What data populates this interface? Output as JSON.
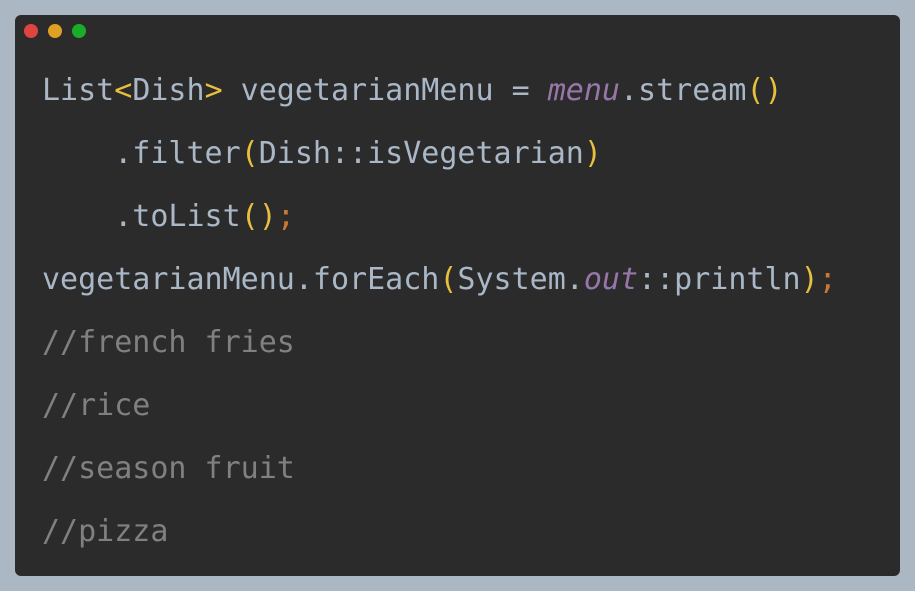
{
  "window": {
    "buttons": [
      {
        "name": "close",
        "color": "#e0443e"
      },
      {
        "name": "minimize",
        "color": "#dea123"
      },
      {
        "name": "zoom",
        "color": "#1aab29"
      }
    ]
  },
  "code": {
    "lines": [
      [
        {
          "t": "List",
          "k": "plain"
        },
        {
          "t": "<",
          "k": "bracket"
        },
        {
          "t": "Dish",
          "k": "plain"
        },
        {
          "t": ">",
          "k": "bracket"
        },
        {
          "t": " vegetarianMenu = ",
          "k": "plain"
        },
        {
          "t": "menu",
          "k": "field"
        },
        {
          "t": ".stream",
          "k": "plain"
        },
        {
          "t": "()",
          "k": "bracket"
        }
      ],
      [
        {
          "t": "    .filter",
          "k": "plain"
        },
        {
          "t": "(",
          "k": "bracket"
        },
        {
          "t": "Dish::isVegetarian",
          "k": "plain"
        },
        {
          "t": ")",
          "k": "bracket"
        }
      ],
      [
        {
          "t": "    .toList",
          "k": "plain"
        },
        {
          "t": "()",
          "k": "bracket"
        },
        {
          "t": ";",
          "k": "semi"
        }
      ],
      [
        {
          "t": "vegetarianMenu.forEach",
          "k": "plain"
        },
        {
          "t": "(",
          "k": "bracket"
        },
        {
          "t": "System.",
          "k": "plain"
        },
        {
          "t": "out",
          "k": "field"
        },
        {
          "t": "::println",
          "k": "plain"
        },
        {
          "t": ")",
          "k": "bracket"
        },
        {
          "t": ";",
          "k": "semi"
        }
      ],
      [
        {
          "t": "//french fries",
          "k": "comment"
        }
      ],
      [
        {
          "t": "//rice",
          "k": "comment"
        }
      ],
      [
        {
          "t": "//season fruit",
          "k": "comment"
        }
      ],
      [
        {
          "t": "//pizza",
          "k": "comment"
        }
      ]
    ]
  }
}
